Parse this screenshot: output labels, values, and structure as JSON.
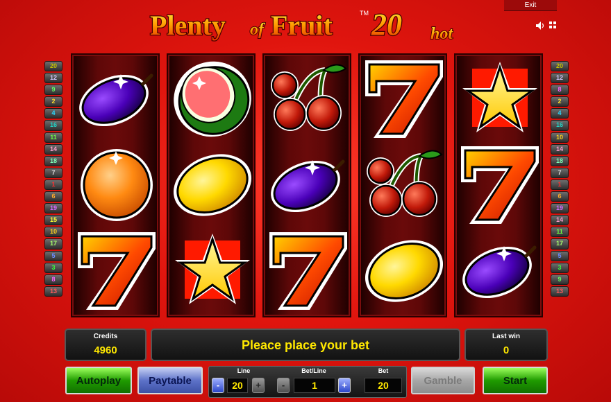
{
  "title": {
    "part1": "Plenty",
    "part2": "of",
    "part3": "Fruit",
    "tm": "TM",
    "number": "20",
    "suffix": "hot"
  },
  "top_bar": {
    "exit_label": "Exit",
    "sound_icon": "speaker-icon",
    "fullscreen_icon": "fullscreen-icon"
  },
  "paylines": {
    "left": [
      "20",
      "12",
      "9",
      "2",
      "4",
      "16",
      "11",
      "14",
      "18",
      "7",
      "1",
      "6",
      "19",
      "15",
      "10",
      "17",
      "5",
      "3",
      "8",
      "13"
    ],
    "right": [
      "20",
      "12",
      "8",
      "2",
      "4",
      "16",
      "10",
      "14",
      "18",
      "7",
      "1",
      "6",
      "19",
      "14",
      "11",
      "17",
      "5",
      "3",
      "9",
      "13"
    ],
    "colors": {
      "20": "#c5c000",
      "12": "#d4c8ff",
      "9": "#62ff62",
      "8": "#ff62ff",
      "2": "#ffde2a",
      "4": "#2ad9ff",
      "16": "#22d0c4",
      "11": "#6cff43",
      "10": "#ffd11a",
      "14": "#ff9fd0",
      "18": "#7dffb7",
      "7": "#dddddd",
      "1": "#ff2f2f",
      "6": "#ffaa2a",
      "19": "#d56bff",
      "15": "#ffff33",
      "17": "#a4ff69",
      "5": "#6b8bff",
      "3": "#38ff38",
      "13": "#ff5a5a"
    }
  },
  "reels": [
    [
      "plum",
      "orange",
      "seven"
    ],
    [
      "watermelon",
      "lemon",
      "star"
    ],
    [
      "cherries",
      "plum",
      "seven"
    ],
    [
      "seven",
      "cherries",
      "lemon"
    ],
    [
      "star",
      "seven",
      "plum"
    ]
  ],
  "info": {
    "credits_label": "Credits",
    "credits_value": "4960",
    "message": "Pleace place your bet",
    "last_win_label": "Last win",
    "last_win_value": "0"
  },
  "controls": {
    "autoplay_label": "Autoplay",
    "paytable_label": "Paytable",
    "line_label": "Line",
    "line_value": "20",
    "bet_line_label": "Bet/Line",
    "bet_line_value": "1",
    "bet_label": "Bet",
    "bet_value": "20",
    "minus": "-",
    "plus": "+",
    "gamble_label": "Gamble",
    "start_label": "Start"
  },
  "colors": {
    "accent_yellow": "#ffe800",
    "background_red": "#e0150e"
  }
}
